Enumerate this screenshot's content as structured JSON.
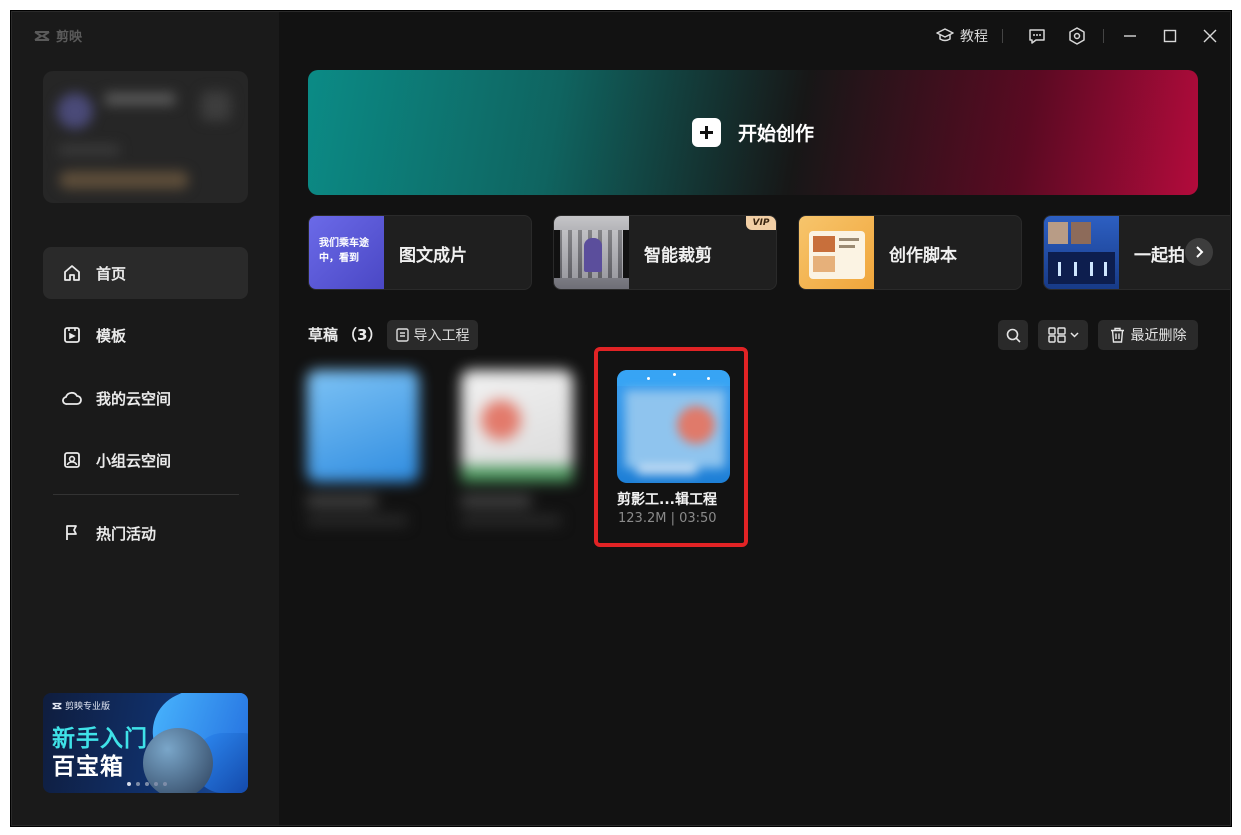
{
  "app": {
    "name": "剪映"
  },
  "topbar": {
    "tutorial_label": "教程"
  },
  "sidebar": {
    "items": [
      {
        "label": "首页"
      },
      {
        "label": "模板"
      },
      {
        "label": "我的云空间"
      },
      {
        "label": "小组云空间"
      },
      {
        "label": "热门活动"
      }
    ],
    "banner": {
      "brand": "剪映专业版",
      "line1": "新手入门",
      "line2": "百宝箱"
    }
  },
  "hero": {
    "label": "开始创作"
  },
  "tools": [
    {
      "label": "图文成片",
      "thumb_text": "我们乘车途中，看到",
      "vip": false
    },
    {
      "label": "智能裁剪",
      "vip": true,
      "vip_label": "VIP"
    },
    {
      "label": "创作脚本",
      "vip": false
    },
    {
      "label": "一起拍",
      "vip": false
    }
  ],
  "drafts": {
    "title": "草稿",
    "count": "（3）",
    "import_label": "导入工程",
    "delete_label": "最近删除",
    "selected": {
      "name": "剪影工...辑工程",
      "meta": "123.2M | 03:50"
    }
  },
  "colors": {
    "accent_red": "#e12325",
    "hero_left": "#0b8b86",
    "hero_right": "#b30b3c"
  }
}
